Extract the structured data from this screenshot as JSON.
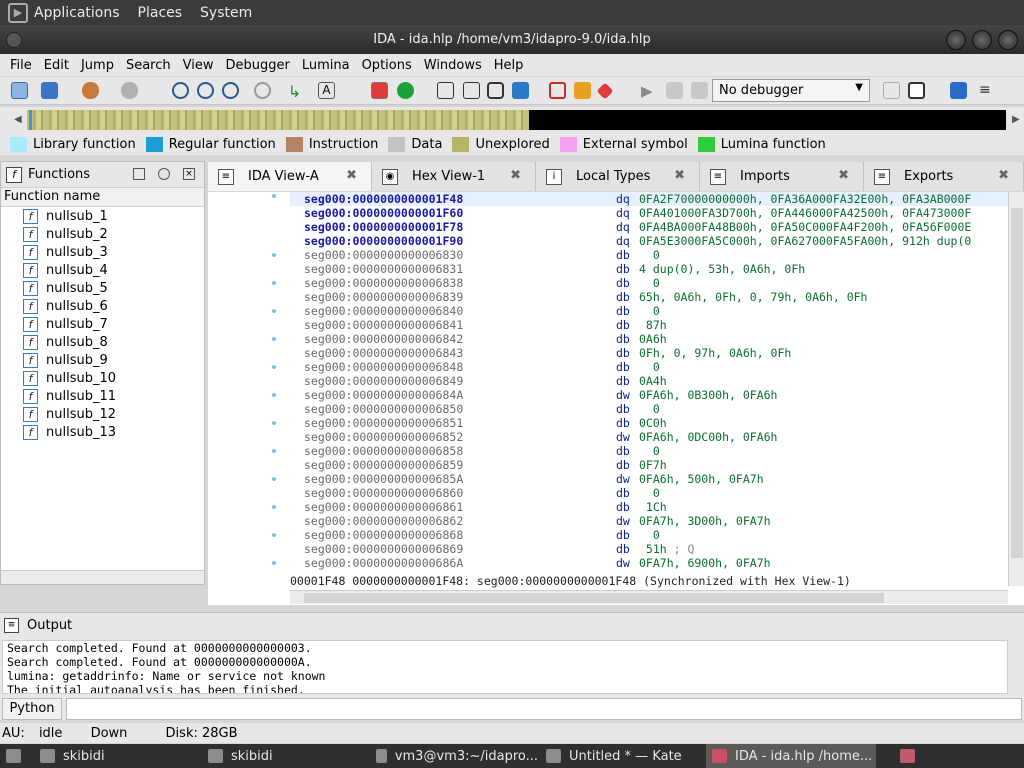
{
  "gnome_panel": {
    "applications": "Applications",
    "places": "Places",
    "system": "System"
  },
  "window": {
    "title": "IDA - ida.hlp /home/vm3/idapro-9.0/ida.hlp"
  },
  "menu": [
    "File",
    "Edit",
    "Jump",
    "Search",
    "View",
    "Debugger",
    "Lumina",
    "Options",
    "Windows",
    "Help"
  ],
  "toolbar": {
    "debugger_select": "No debugger"
  },
  "legend": [
    {
      "label": "Library function",
      "color": "#a8eaff"
    },
    {
      "label": "Regular function",
      "color": "#1a9ed4"
    },
    {
      "label": "Instruction",
      "color": "#b48266"
    },
    {
      "label": "Data",
      "color": "#c4c4c4"
    },
    {
      "label": "Unexplored",
      "color": "#b5b56a"
    },
    {
      "label": "External symbol",
      "color": "#f6a2ef"
    },
    {
      "label": "Lumina function",
      "color": "#2fcc3c"
    }
  ],
  "functions": {
    "title": "Functions",
    "column": "Function name",
    "items": [
      "nullsub_1",
      "nullsub_2",
      "nullsub_3",
      "nullsub_4",
      "nullsub_5",
      "nullsub_6",
      "nullsub_7",
      "nullsub_8",
      "nullsub_9",
      "nullsub_10",
      "nullsub_11",
      "nullsub_12",
      "nullsub_13"
    ]
  },
  "tabs": [
    {
      "label": "IDA View-A"
    },
    {
      "label": "Hex View-1"
    },
    {
      "label": "Local Types"
    },
    {
      "label": "Imports"
    },
    {
      "label": "Exports"
    }
  ],
  "disasm": [
    {
      "addr": "seg000:0000000000001F48",
      "mn": "dq",
      "op": "0FA2F70000000000h, 0FA36A000FA32E00h, 0FA3AB000F"
    },
    {
      "addr": "seg000:0000000000001F60",
      "mn": "dq",
      "op": "0FA401000FA3D700h, 0FA446000FA42500h, 0FA473000F"
    },
    {
      "addr": "seg000:0000000000001F78",
      "mn": "dq",
      "op": "0FA4BA000FA48B00h, 0FA50C000FA4F200h, 0FA56F000E"
    },
    {
      "addr": "seg000:0000000000001F90",
      "mn": "dq",
      "op": "0FA5E3000FA5C000h, 0FA627000FA5FA00h, 912h dup(0"
    },
    {
      "addr": "seg000:0000000000006830",
      "mn": "db",
      "op": "  0"
    },
    {
      "addr": "seg000:0000000000006831",
      "mn": "db",
      "op": "4 dup(0), 53h, 0A6h, 0Fh"
    },
    {
      "addr": "seg000:0000000000006838",
      "mn": "db",
      "op": "  0"
    },
    {
      "addr": "seg000:0000000000006839",
      "mn": "db",
      "op": "65h, 0A6h, 0Fh, 0, 79h, 0A6h, 0Fh"
    },
    {
      "addr": "seg000:0000000000006840",
      "mn": "db",
      "op": "  0"
    },
    {
      "addr": "seg000:0000000000006841",
      "mn": "db",
      "op": " 87h"
    },
    {
      "addr": "seg000:0000000000006842",
      "mn": "db",
      "op": "0A6h"
    },
    {
      "addr": "seg000:0000000000006843",
      "mn": "db",
      "op": "0Fh, 0, 97h, 0A6h, 0Fh"
    },
    {
      "addr": "seg000:0000000000006848",
      "mn": "db",
      "op": "  0"
    },
    {
      "addr": "seg000:0000000000006849",
      "mn": "db",
      "op": "0A4h"
    },
    {
      "addr": "seg000:000000000000684A",
      "mn": "dw",
      "op": "0FA6h, 0B300h, 0FA6h"
    },
    {
      "addr": "seg000:0000000000006850",
      "mn": "db",
      "op": "  0"
    },
    {
      "addr": "seg000:0000000000006851",
      "mn": "db",
      "op": "0C0h"
    },
    {
      "addr": "seg000:0000000000006852",
      "mn": "dw",
      "op": "0FA6h, 0DC00h, 0FA6h"
    },
    {
      "addr": "seg000:0000000000006858",
      "mn": "db",
      "op": "  0"
    },
    {
      "addr": "seg000:0000000000006859",
      "mn": "db",
      "op": "0F7h"
    },
    {
      "addr": "seg000:000000000000685A",
      "mn": "dw",
      "op": "0FA6h, 500h, 0FA7h"
    },
    {
      "addr": "seg000:0000000000006860",
      "mn": "db",
      "op": "  0"
    },
    {
      "addr": "seg000:0000000000006861",
      "mn": "db",
      "op": " 1Ch"
    },
    {
      "addr": "seg000:0000000000006862",
      "mn": "dw",
      "op": "0FA7h, 3D00h, 0FA7h"
    },
    {
      "addr": "seg000:0000000000006868",
      "mn": "db",
      "op": "  0"
    },
    {
      "addr": "seg000:0000000000006869",
      "mn": "db",
      "op": " 51h",
      "cm": " ; Q"
    },
    {
      "addr": "seg000:000000000000686A",
      "mn": "dw",
      "op": "0FA7h, 6900h, 0FA7h"
    }
  ],
  "sync_line": "00001F48 0000000000001F48: seg000:0000000000001F48 (Synchronized with Hex View-1)",
  "output": {
    "title": "Output",
    "lines": [
      "Search completed. Found at 0000000000000003.",
      "Search completed. Found at 000000000000000A.",
      "lumina: getaddrinfo: Name or service not known",
      "The initial autoanalysis has been finished."
    ]
  },
  "python_button": "Python",
  "status": {
    "au": "AU:",
    "state": "idle",
    "dir": "Down",
    "disk": "Disk: 28GB"
  },
  "taskbar": [
    {
      "label": "skibidi"
    },
    {
      "label": "skibidi"
    },
    {
      "label": "vm3@vm3:~/idapro..."
    },
    {
      "label": "Untitled * — Kate"
    },
    {
      "label": "IDA - ida.hlp /home..."
    }
  ]
}
